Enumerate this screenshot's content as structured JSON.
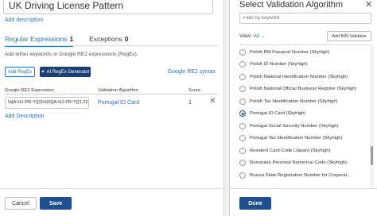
{
  "left": {
    "title": "UK Driving License Pattern",
    "add_description": "Add description",
    "tabs": [
      {
        "label": "Regular Expressions",
        "count": "1"
      },
      {
        "label": "Exceptions",
        "count": "0"
      }
    ],
    "hint": "Add either keywords or Google RE2 expressions (RegEx).",
    "add_regex_button": "Add RegEx",
    "ai_regex_button": "AI RegEx Generator",
    "re2_syntax_link": "Google RE2 syntax",
    "table": {
      "headers": [
        "Google RE2 Expression",
        "Validation Algorithm",
        "Score"
      ],
      "rows": [
        {
          "expression": "\\b[A-HJ-PR-Y]{2}\\d{6}[A-HJ-PR-Y]{1,2}\\b",
          "algorithm": "Portugal ID Card",
          "score": "1"
        }
      ]
    },
    "add_description_row": "Add Description",
    "cancel_button": "Cancel",
    "save_button": "Save"
  },
  "right": {
    "title": "Select Validation Algorithm",
    "search_placeholder": "Filter by keyword",
    "view_label": "View:",
    "view_value": "All",
    "add_bin_button": "Add BIN Validator",
    "items": [
      {
        "label": "Polish BM Passport Number (Skyhigh)",
        "selected": false
      },
      {
        "label": "Polish ID Number (Skyhigh)",
        "selected": false
      },
      {
        "label": "Polish National Identification Number (Skyhigh)",
        "selected": false
      },
      {
        "label": "Polish National Official Business Register (Skyhigh)",
        "selected": false
      },
      {
        "label": "Polish Tax Identification Number (Skyhigh)",
        "selected": false
      },
      {
        "label": "Portugal ID Card (Skyhigh)",
        "selected": true
      },
      {
        "label": "Portugal Social Security Number (Skyhigh)",
        "selected": false
      },
      {
        "label": "Portugal Tax Identification Number (Skyhigh)",
        "selected": false
      },
      {
        "label": "Resident Card Code (Japan) (Skyhigh)",
        "selected": false
      },
      {
        "label": "Romanian Personal Numerical Code (Skyhigh)",
        "selected": false
      },
      {
        "label": "Russia State Registration Number for Corporat...",
        "selected": false
      }
    ],
    "done_button": "Done"
  }
}
